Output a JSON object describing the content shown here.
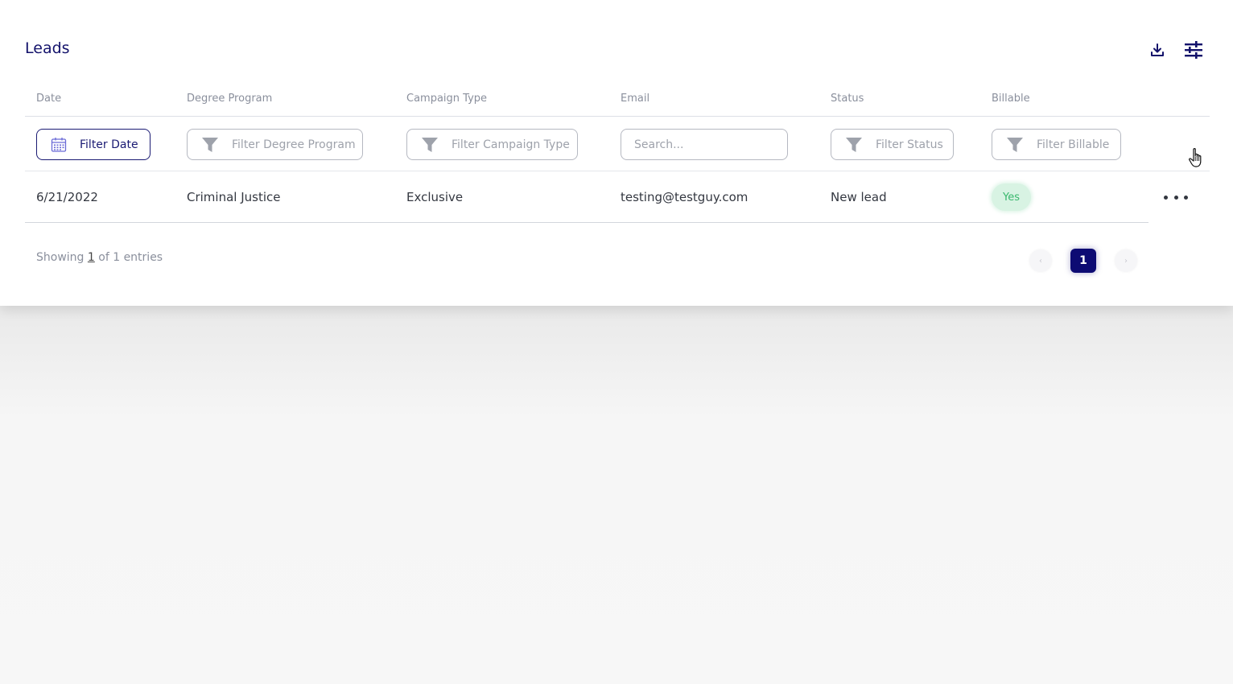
{
  "page": {
    "title": "Leads",
    "download_icon": "download-icon",
    "settings_icon": "sliders-icon"
  },
  "table": {
    "columns": [
      "Date",
      "Degree Program",
      "Campaign Type",
      "Email",
      "Status",
      "Billable"
    ],
    "filters": {
      "date_label": "Filter Date",
      "degree_program_placeholder": "Filter Degree Program",
      "campaign_type_placeholder": "Filter Campaign Type",
      "email_placeholder": "Search...",
      "status_placeholder": "Filter Status",
      "billable_placeholder": "Filter Billable"
    },
    "rows": [
      {
        "date": "6/21/2022",
        "degree_program": "Criminal Justice",
        "campaign_type": "Exclusive",
        "email": "testing@testguy.com",
        "status": "New lead",
        "billable": "Yes"
      }
    ]
  },
  "footer": {
    "showing_prefix": "Showing",
    "showing_count": "1",
    "showing_suffix": "of 1 entries"
  },
  "pagination": {
    "prev": "‹",
    "current": "1",
    "next": "›"
  },
  "colors": {
    "brand": "#13126b",
    "active_page": "#0d0b73",
    "billable_bg": "#d8f3e3",
    "billable_text": "#39b86d"
  }
}
